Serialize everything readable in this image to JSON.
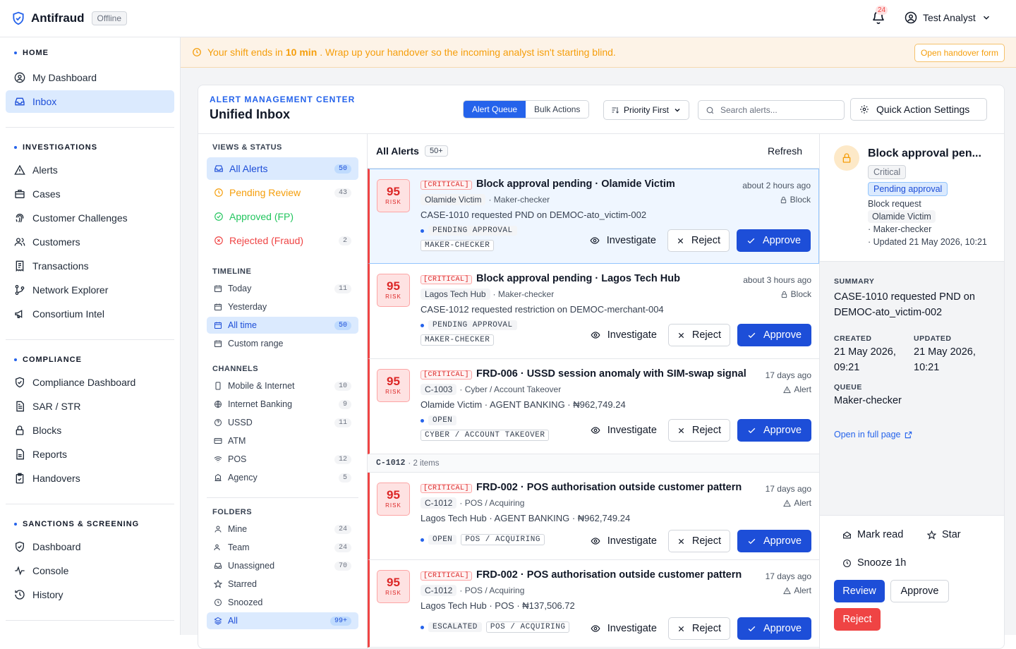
{
  "app": {
    "name": "Antifraud",
    "status": "Offline",
    "notifications": "24",
    "user": "Test Analyst"
  },
  "sidebar": {
    "sections": [
      {
        "title": "HOME",
        "items": [
          {
            "label": "My Dashboard",
            "icon": "user-circle-icon"
          },
          {
            "label": "Inbox",
            "icon": "inbox-icon",
            "active": true
          }
        ]
      },
      {
        "title": "INVESTIGATIONS",
        "items": [
          {
            "label": "Alerts",
            "icon": "warning-icon"
          },
          {
            "label": "Cases",
            "icon": "briefcase-icon"
          },
          {
            "label": "Customer Challenges",
            "icon": "fingerprint-icon"
          },
          {
            "label": "Customers",
            "icon": "users-icon"
          },
          {
            "label": "Transactions",
            "icon": "receipt-icon"
          },
          {
            "label": "Network Explorer",
            "icon": "network-icon"
          },
          {
            "label": "Consortium Intel",
            "icon": "megaphone-icon"
          }
        ]
      },
      {
        "title": "COMPLIANCE",
        "items": [
          {
            "label": "Compliance Dashboard",
            "icon": "shield-check-icon"
          },
          {
            "label": "SAR / STR",
            "icon": "document-icon"
          },
          {
            "label": "Blocks",
            "icon": "lock-icon"
          },
          {
            "label": "Reports",
            "icon": "report-icon"
          },
          {
            "label": "Handovers",
            "icon": "clipboard-check-icon"
          }
        ]
      },
      {
        "title": "SANCTIONS & SCREENING",
        "items": [
          {
            "label": "Dashboard",
            "icon": "shield-check-icon"
          },
          {
            "label": "Console",
            "icon": "activity-icon"
          },
          {
            "label": "History",
            "icon": "history-icon"
          }
        ]
      }
    ]
  },
  "banner": {
    "pre": "Your shift ends in",
    "time": "10 min",
    "post": ". Wrap up your handover so the incoming analyst isn't starting blind.",
    "button": "Open handover form"
  },
  "header": {
    "eyebrow": "ALERT MANAGEMENT CENTER",
    "title": "Unified Inbox",
    "tabs": [
      "Alert Queue",
      "Bulk Actions"
    ],
    "sort": "Priority First",
    "search_placeholder": "Search alerts...",
    "quick_settings": "Quick Action Settings"
  },
  "filters": {
    "views_title": "VIEWS & STATUS",
    "views": [
      {
        "label": "All Alerts",
        "count": "50",
        "color": "#1d4ed8"
      },
      {
        "label": "Pending Review",
        "count": "43",
        "color": "#f59e0b"
      },
      {
        "label": "Approved (FP)",
        "count": "",
        "color": "#22c55e"
      },
      {
        "label": "Rejected (Fraud)",
        "count": "2",
        "color": "#ef4444"
      }
    ],
    "timeline_title": "TIMELINE",
    "timeline": [
      {
        "label": "Today",
        "count": "11"
      },
      {
        "label": "Yesterday",
        "count": ""
      },
      {
        "label": "All time",
        "count": "50"
      },
      {
        "label": "Custom range",
        "count": ""
      }
    ],
    "channels_title": "CHANNELS",
    "channels": [
      {
        "label": "Mobile & Internet",
        "count": "10"
      },
      {
        "label": "Internet Banking",
        "count": "9"
      },
      {
        "label": "USSD",
        "count": "11"
      },
      {
        "label": "ATM",
        "count": ""
      },
      {
        "label": "POS",
        "count": "12"
      },
      {
        "label": "Agency",
        "count": "5"
      }
    ],
    "folders_title": "FOLDERS",
    "folders": [
      {
        "label": "Mine",
        "count": "24"
      },
      {
        "label": "Team",
        "count": "24"
      },
      {
        "label": "Unassigned",
        "count": "70"
      },
      {
        "label": "Starred",
        "count": ""
      },
      {
        "label": "Snoozed",
        "count": ""
      },
      {
        "label": "All",
        "count": "99+"
      }
    ]
  },
  "list": {
    "title": "All Alerts",
    "count": "50+",
    "refresh": "Refresh",
    "actions": {
      "investigate": "Investigate",
      "reject": "Reject",
      "approve": "Approve"
    },
    "alerts": [
      {
        "risk": "95",
        "risk_label": "RISK",
        "severity": "[CRITICAL]",
        "title": "Block approval pending · Olamide Victim",
        "time": "about 2 hours ago",
        "type": "Block",
        "meta1": "Olamide Victim",
        "meta2": "· Maker-checker",
        "desc": "CASE-1010 requested PND on DEMOC-ato_victim-002",
        "status": "PENDING APPROVAL",
        "tag": "MAKER-CHECKER"
      },
      {
        "risk": "95",
        "risk_label": "RISK",
        "severity": "[CRITICAL]",
        "title": "Block approval pending · Lagos Tech Hub",
        "time": "about 3 hours ago",
        "type": "Block",
        "meta1": "Lagos Tech Hub",
        "meta2": "· Maker-checker",
        "desc": "CASE-1012 requested restriction on DEMOC-merchant-004",
        "status": "PENDING APPROVAL",
        "tag": "MAKER-CHECKER"
      },
      {
        "risk": "95",
        "risk_label": "RISK",
        "severity": "[CRITICAL]",
        "title": "FRD-006 · USSD session anomaly with SIM-swap signal",
        "time": "17 days ago",
        "type": "Alert",
        "meta1": "C-1003",
        "meta2": "· Cyber / Account Takeover",
        "desc": "Olamide Victim · AGENT BANKING · ₦962,749.24",
        "status": "OPEN",
        "tag": "CYBER / ACCOUNT TAKEOVER"
      },
      {
        "risk": "95",
        "risk_label": "RISK",
        "severity": "[CRITICAL]",
        "title": "FRD-002 · POS authorisation outside customer pattern",
        "time": "17 days ago",
        "type": "Alert",
        "meta1": "C-1012",
        "meta2": "· POS / Acquiring",
        "desc": "Lagos Tech Hub · AGENT BANKING · ₦962,749.24",
        "status": "OPEN",
        "tag": "POS / ACQUIRING"
      },
      {
        "risk": "95",
        "risk_label": "RISK",
        "severity": "[CRITICAL]",
        "title": "FRD-002 · POS authorisation outside customer pattern",
        "time": "17 days ago",
        "type": "Alert",
        "meta1": "C-1012",
        "meta2": "· POS / Acquiring",
        "desc": "Lagos Tech Hub · POS · ₦137,506.72",
        "status": "ESCALATED",
        "tag": "POS / ACQUIRING"
      }
    ],
    "group": {
      "id": "C-1012",
      "label": "· 2 items"
    }
  },
  "detail": {
    "title": "Block approval pen...",
    "severity": "Critical",
    "status": "Pending approval",
    "kind": "Block request",
    "customer": "Olamide Victim",
    "queue_line": "· Maker-checker",
    "updated_line": "· Updated 21 May 2026, 10:21",
    "summary_label": "SUMMARY",
    "summary": "CASE-1010 requested PND on DEMOC-ato_victim-002",
    "created_label": "CREATED",
    "created": "21 May 2026, 09:21",
    "updated_label": "UPDATED",
    "updated": "21 May 2026, 10:21",
    "queue_label": "QUEUE",
    "queue": "Maker-checker",
    "open_full": "Open in full page",
    "mark_read": "Mark read",
    "star": "Star",
    "snooze": "Snooze 1h",
    "review": "Review",
    "approve": "Approve",
    "reject": "Reject"
  },
  "colors": {
    "accent": "#2563eb",
    "danger": "#ef4444",
    "warning": "#f59e0b",
    "success": "#22c55e"
  }
}
